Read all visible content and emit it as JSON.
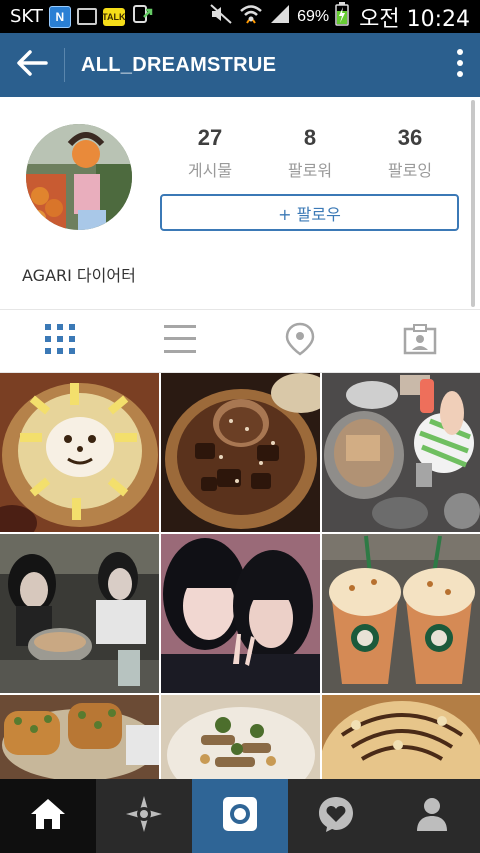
{
  "status_bar": {
    "carrier": "SKT",
    "n_badge": "N",
    "talk_badge": "TALK",
    "battery": "69%",
    "time": "오전 10:24",
    "icons": [
      "n-app-icon",
      "gallery-icon",
      "kakaotalk-icon",
      "upload-icon",
      "mute-icon",
      "wifi-icon",
      "signal-icon",
      "battery-icon"
    ]
  },
  "toolbar": {
    "title": "ALL_DREAMSTRUE",
    "back_icon": "arrow-left-icon",
    "menu_icon": "overflow-menu-icon"
  },
  "profile": {
    "stats": [
      {
        "value": "27",
        "label": "게시물"
      },
      {
        "value": "8",
        "label": "팔로워"
      },
      {
        "value": "36",
        "label": "팔로잉"
      }
    ],
    "follow_button": "+ 팔로우",
    "bio": "AGARI 다이어터"
  },
  "tabs": [
    {
      "name": "grid-view",
      "icon": "grid-icon",
      "active": true
    },
    {
      "name": "list-view",
      "icon": "list-icon",
      "active": false
    },
    {
      "name": "map-view",
      "icon": "location-pin-icon",
      "active": false
    },
    {
      "name": "tagged-view",
      "icon": "tagged-photo-icon",
      "active": false
    }
  ],
  "photos": [
    {
      "desc": "bingsu-sun-face"
    },
    {
      "desc": "chocolate-bingsu"
    },
    {
      "desc": "cafe-table"
    },
    {
      "desc": "friends-selfie-restaurant"
    },
    {
      "desc": "two-girls-peace-sign"
    },
    {
      "desc": "starbucks-frappuccinos"
    },
    {
      "desc": "garlic-bread"
    },
    {
      "desc": "salad-plate"
    },
    {
      "desc": "pizza-drizzle"
    }
  ],
  "bottom_nav": [
    {
      "name": "home",
      "icon": "home-icon",
      "active": true
    },
    {
      "name": "explore",
      "icon": "explore-icon",
      "active": false
    },
    {
      "name": "camera",
      "icon": "camera-icon",
      "active": false
    },
    {
      "name": "activity",
      "icon": "activity-heart-icon",
      "active": false
    },
    {
      "name": "profile",
      "icon": "profile-icon",
      "active": false
    }
  ],
  "colors": {
    "toolbar": "#2b5f8e",
    "accent": "#3b79b6",
    "nav_bg": "#1e1e1e",
    "camera_bg": "#2f6596"
  }
}
